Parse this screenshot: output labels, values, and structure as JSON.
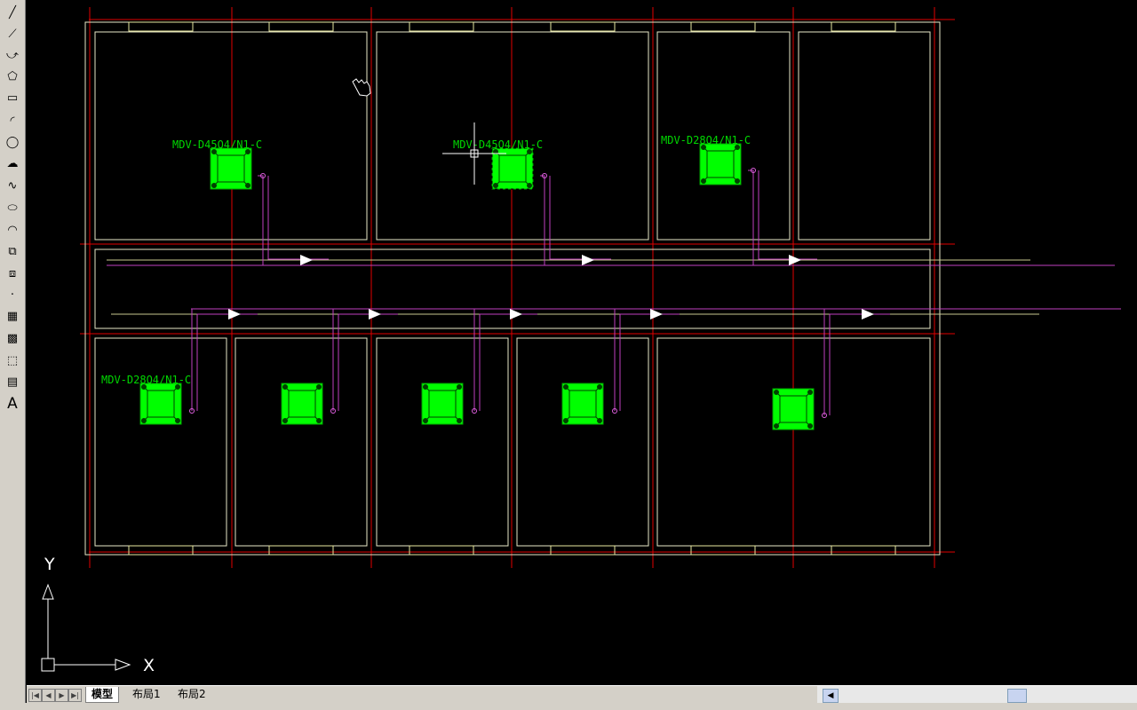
{
  "toolbar": {
    "tools": [
      {
        "name": "line-icon",
        "glyph": "╱"
      },
      {
        "name": "construction-line-icon",
        "glyph": "⟋"
      },
      {
        "name": "polyline-icon",
        "glyph": "⤻"
      },
      {
        "name": "polygon-icon",
        "glyph": "⬠"
      },
      {
        "name": "rectangle-icon",
        "glyph": "▭"
      },
      {
        "name": "arc-icon",
        "glyph": "◜"
      },
      {
        "name": "circle-icon",
        "glyph": "◯"
      },
      {
        "name": "revision-cloud-icon",
        "glyph": "☁"
      },
      {
        "name": "spline-icon",
        "glyph": "∿"
      },
      {
        "name": "ellipse-icon",
        "glyph": "⬭"
      },
      {
        "name": "ellipse-arc-icon",
        "glyph": "◠"
      },
      {
        "name": "insert-block-icon",
        "glyph": "⧉"
      },
      {
        "name": "make-block-icon",
        "glyph": "⧈"
      },
      {
        "name": "point-icon",
        "glyph": "·"
      },
      {
        "name": "hatch-icon",
        "glyph": "▦"
      },
      {
        "name": "gradient-icon",
        "glyph": "▩"
      },
      {
        "name": "region-icon",
        "glyph": "⬚"
      },
      {
        "name": "table-icon",
        "glyph": "▤"
      },
      {
        "name": "multiline-text-icon",
        "glyph": "A"
      }
    ]
  },
  "drawing": {
    "unit_labels": [
      "MDV-D45Q4/N1-C",
      "MDV-D45Q4/N1-C",
      "MDV-D28Q4/N1-C",
      "MDV-D28Q4/N1-C"
    ],
    "colors": {
      "background": "#000000",
      "walls": "#e8e8c8",
      "axis_grid": "#e00000",
      "windows": "#e8e8a0",
      "units": "#00ff00",
      "piping": "#c040c0",
      "arrows": "#ffffff"
    }
  },
  "ucs": {
    "x_label": "X",
    "y_label": "Y"
  },
  "tabs": {
    "items": [
      "模型",
      "布局1",
      "布局2"
    ],
    "active": "模型"
  }
}
